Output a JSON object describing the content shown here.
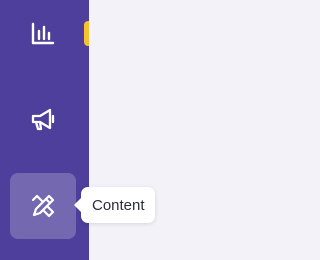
{
  "sidebar": {
    "background_color": "#4d3f9b",
    "items": [
      {
        "id": "analytics",
        "icon": "bar-chart-icon",
        "active": false
      },
      {
        "id": "marketing",
        "icon": "megaphone-icon",
        "active": false
      },
      {
        "id": "content",
        "icon": "pencil-ruler-icon",
        "active": true
      }
    ],
    "indicator_color": "#f6c32f"
  },
  "tooltip": {
    "label": "Content"
  },
  "main": {
    "background_color": "#f3f2f8"
  }
}
